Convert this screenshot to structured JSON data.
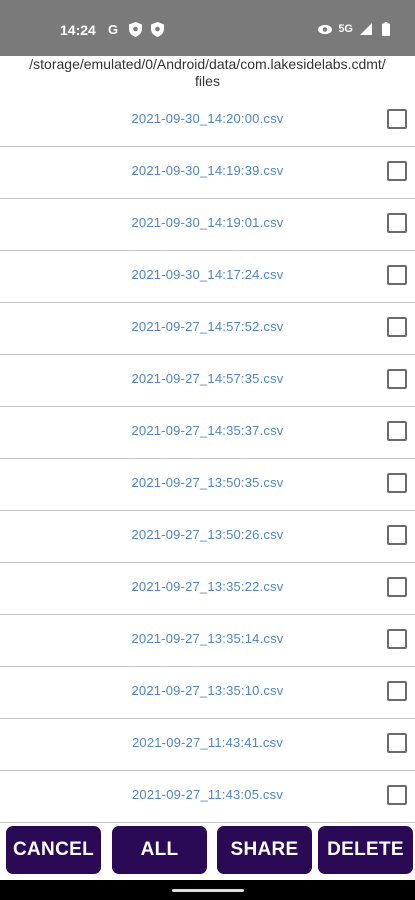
{
  "status_bar": {
    "time": "14:24",
    "left_icons": [
      "google-g-icon",
      "shield-icon",
      "shield-icon"
    ],
    "network_label": "5G",
    "right_icons": [
      "eye-icon",
      "signal-icon",
      "battery-icon"
    ]
  },
  "header": {
    "path_line1": "/storage/emulated/0/Android/data/com.lakesidelabs.cdmt/",
    "path_line2": "files"
  },
  "files": [
    {
      "name": "2021-09-30_14:20:00.csv",
      "checked": false
    },
    {
      "name": "2021-09-30_14:19:39.csv",
      "checked": false
    },
    {
      "name": "2021-09-30_14:19:01.csv",
      "checked": false
    },
    {
      "name": "2021-09-30_14:17:24.csv",
      "checked": false
    },
    {
      "name": "2021-09-27_14:57:52.csv",
      "checked": false
    },
    {
      "name": "2021-09-27_14:57:35.csv",
      "checked": false
    },
    {
      "name": "2021-09-27_14:35:37.csv",
      "checked": false
    },
    {
      "name": "2021-09-27_13:50:35.csv",
      "checked": false
    },
    {
      "name": "2021-09-27_13:50:26.csv",
      "checked": false
    },
    {
      "name": "2021-09-27_13:35:22.csv",
      "checked": false
    },
    {
      "name": "2021-09-27_13:35:14.csv",
      "checked": false
    },
    {
      "name": "2021-09-27_13:35:10.csv",
      "checked": false
    },
    {
      "name": "2021-09-27_11:43:41.csv",
      "checked": false
    },
    {
      "name": "2021-09-27_11:43:05.csv",
      "checked": false
    }
  ],
  "buttons": {
    "cancel": "CANCEL",
    "all": "ALL",
    "share": "SHARE",
    "delete": "DELETE"
  },
  "colors": {
    "status_bar": "#7a7a7a",
    "file_link": "#4f86c6",
    "button_bg": "#2a0a55",
    "divider": "#c7c7c7"
  }
}
